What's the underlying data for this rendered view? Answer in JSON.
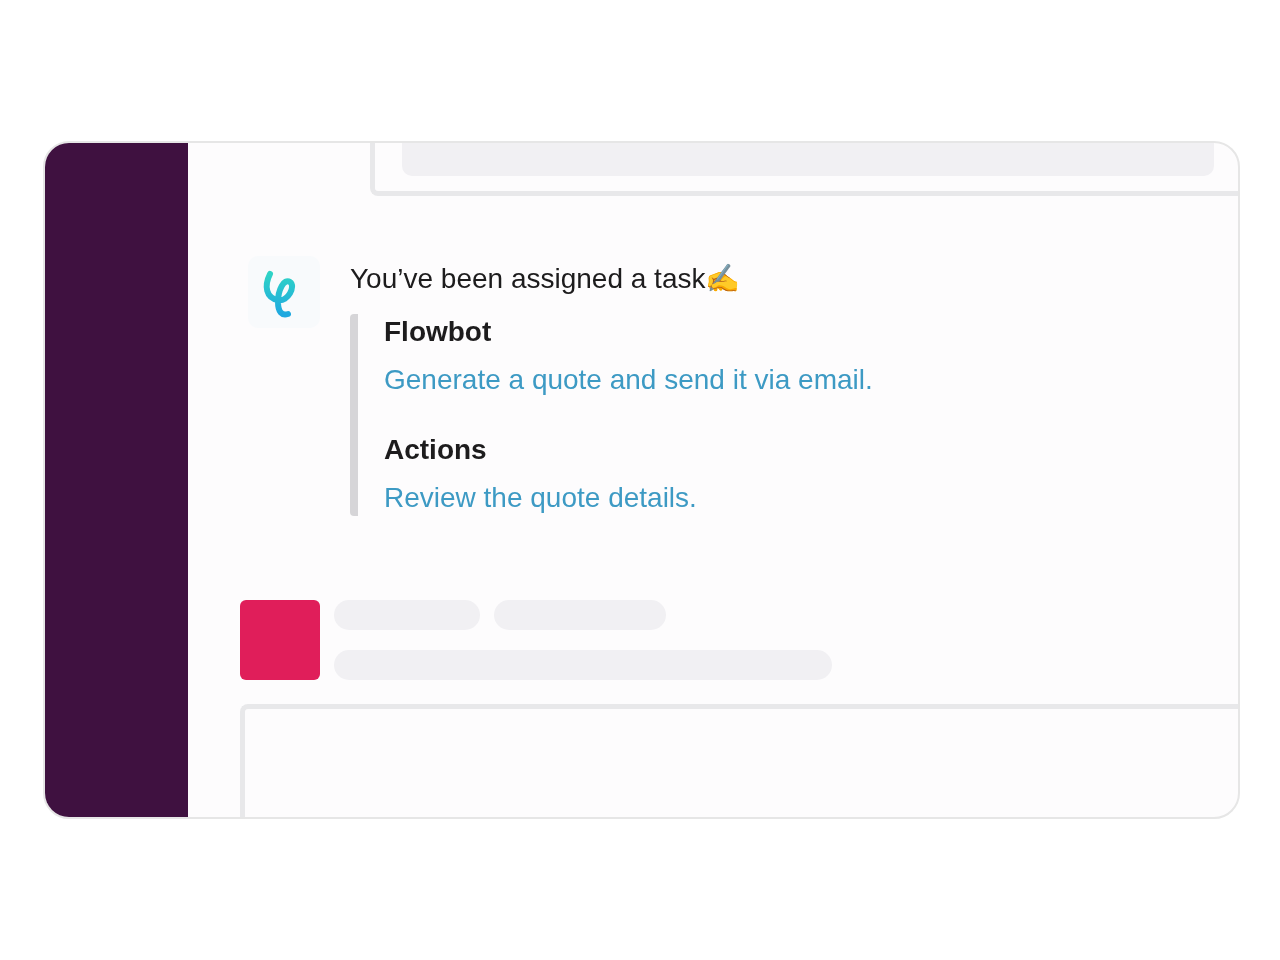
{
  "message": {
    "text": "You’ve been assigned a task✍️"
  },
  "attachment": {
    "sections": [
      {
        "heading": "Flowbot",
        "text": "Generate a quote and send it via email."
      },
      {
        "heading": "Actions",
        "text": "Review the quote details."
      }
    ]
  }
}
